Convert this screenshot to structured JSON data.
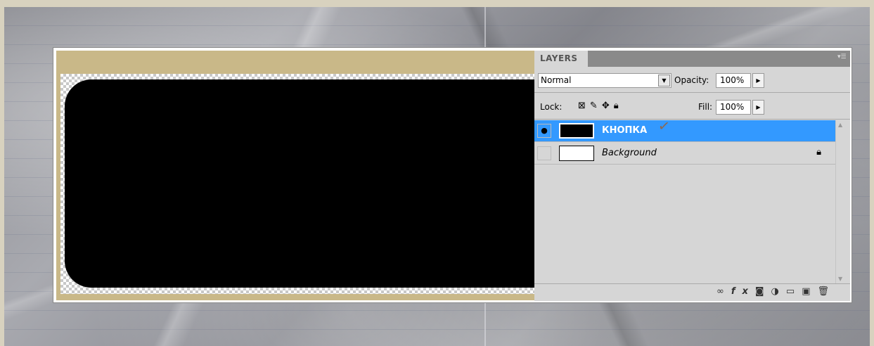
{
  "panel": {
    "tab_label": "LAYERS",
    "blend_mode": "Normal",
    "opacity_label": "Opacity:",
    "opacity_value": "100%",
    "lock_label": "Lock:",
    "fill_label": "Fill:",
    "fill_value": "100%",
    "layers": [
      {
        "name": "КНОПКА",
        "visible": true,
        "selected": true,
        "thumbnail_color": "#000000"
      },
      {
        "name": "Background",
        "visible": false,
        "selected": false,
        "locked": true,
        "thumbnail_color": "#ffffff"
      }
    ]
  },
  "colors": {
    "selection": "#3399ff",
    "panel_bg": "#d6d6d6",
    "canvas_border": "#c9b888",
    "shape": "#000000"
  },
  "icons": {
    "lock_row": [
      "lock-transparent-icon",
      "lock-image-icon",
      "lock-position-icon",
      "lock-all-icon"
    ],
    "bottom_bar": [
      "link-icon",
      "fx-icon",
      "mask-icon",
      "adjustment-icon",
      "group-icon",
      "new-layer-icon",
      "trash-icon"
    ]
  }
}
